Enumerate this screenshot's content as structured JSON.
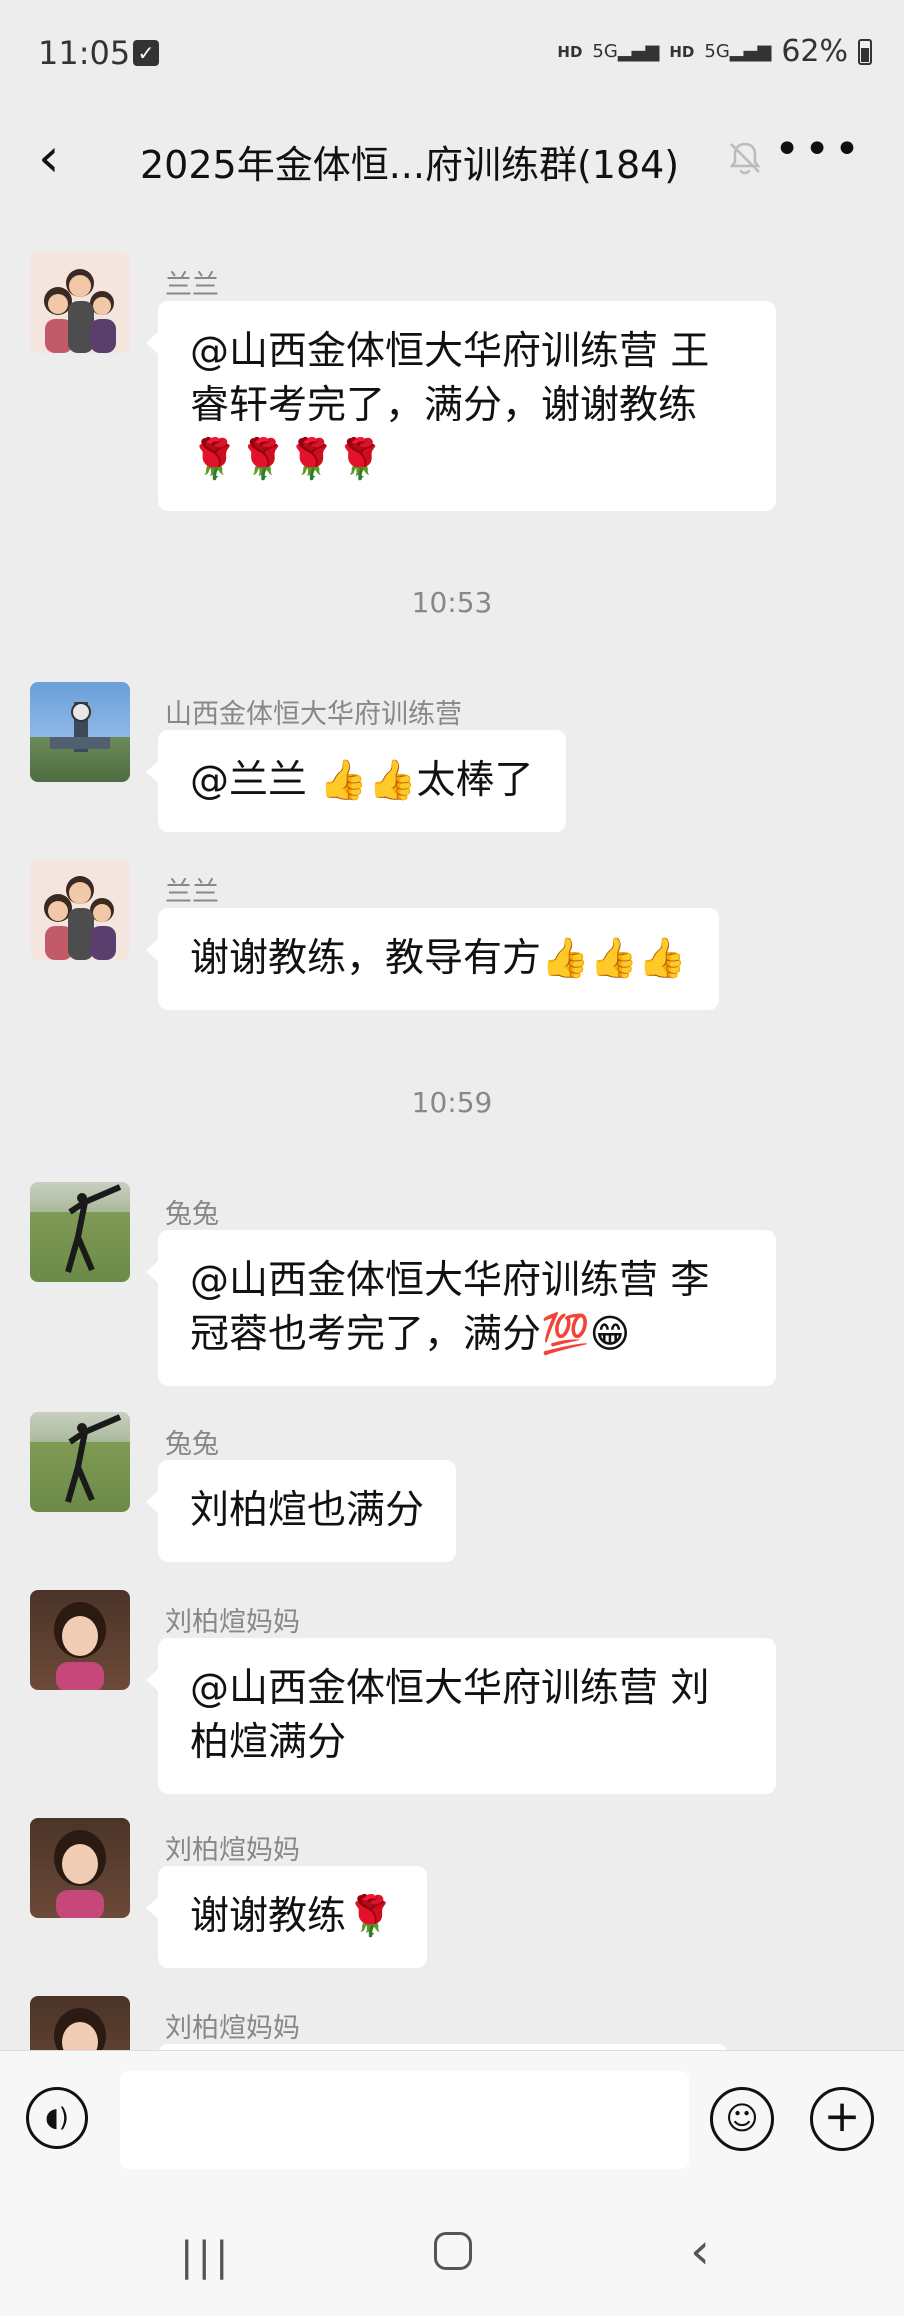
{
  "status_bar": {
    "time": "11:05",
    "net1": "HD",
    "sig1": "5G",
    "net2": "HD",
    "sig2": "5G",
    "battery": "62%"
  },
  "nav": {
    "back_icon": "chevron-left-icon",
    "title": "2025年金体恒...府训练群(184)",
    "mute_icon": "bell-muted-icon",
    "more_icon": "more-dots-icon"
  },
  "messages": [
    {
      "sender": "兰兰",
      "text": "@山西金体恒大华府训练营  王睿轩考完了，满分，谢谢教练🌹🌹🌹🌹"
    },
    {
      "sender": "山西金体恒大华府训练营",
      "text": "@兰兰 👍👍太棒了"
    },
    {
      "sender": "兰兰",
      "text": "谢谢教练，教导有方👍👍👍"
    },
    {
      "sender": "兔兔",
      "text": "@山西金体恒大华府训练营  李冠蓉也考完了，满分💯😁"
    },
    {
      "sender": "兔兔",
      "text": "刘柏煊也满分"
    },
    {
      "sender": "刘柏煊妈妈",
      "text": "@山西金体恒大华府训练营  刘柏煊满分"
    },
    {
      "sender": "刘柏煊妈妈",
      "text": "谢谢教练🌹"
    },
    {
      "sender": "刘柏煊妈妈",
      "text": ""
    }
  ],
  "timestamps": [
    "10:53",
    "10:59"
  ],
  "input_bar": {
    "voice_icon": "voice-icon",
    "input_value": "",
    "emoji_icon": "emoji-icon",
    "plus_icon": "plus-icon"
  },
  "system_nav": {
    "recent_icon": "recent-apps-icon",
    "home_icon": "home-icon",
    "back_icon": "back-icon"
  }
}
